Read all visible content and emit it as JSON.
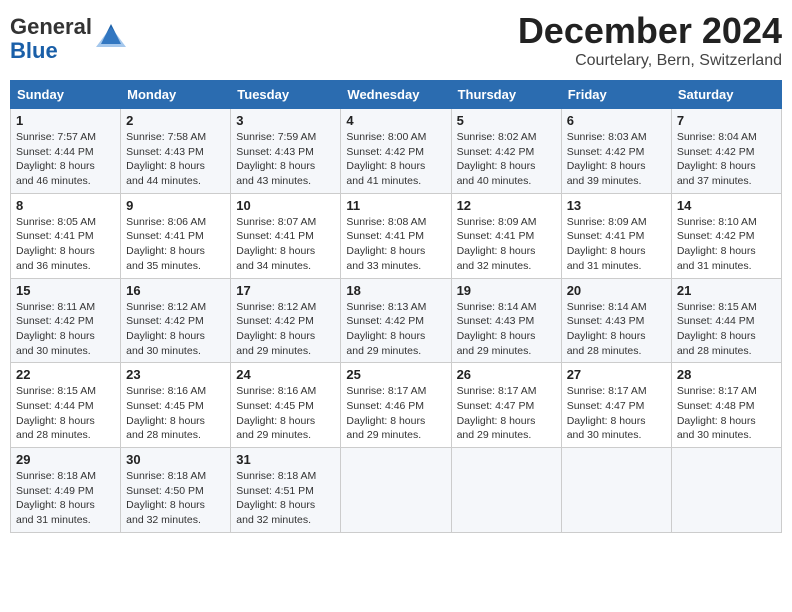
{
  "header": {
    "logo_line1": "General",
    "logo_line2": "Blue",
    "month": "December 2024",
    "location": "Courtelary, Bern, Switzerland"
  },
  "days_of_week": [
    "Sunday",
    "Monday",
    "Tuesday",
    "Wednesday",
    "Thursday",
    "Friday",
    "Saturday"
  ],
  "weeks": [
    [
      {
        "day": 1,
        "sunrise": "7:57 AM",
        "sunset": "4:44 PM",
        "daylight": "8 hours and 46 minutes."
      },
      {
        "day": 2,
        "sunrise": "7:58 AM",
        "sunset": "4:43 PM",
        "daylight": "8 hours and 44 minutes."
      },
      {
        "day": 3,
        "sunrise": "7:59 AM",
        "sunset": "4:43 PM",
        "daylight": "8 hours and 43 minutes."
      },
      {
        "day": 4,
        "sunrise": "8:00 AM",
        "sunset": "4:42 PM",
        "daylight": "8 hours and 41 minutes."
      },
      {
        "day": 5,
        "sunrise": "8:02 AM",
        "sunset": "4:42 PM",
        "daylight": "8 hours and 40 minutes."
      },
      {
        "day": 6,
        "sunrise": "8:03 AM",
        "sunset": "4:42 PM",
        "daylight": "8 hours and 39 minutes."
      },
      {
        "day": 7,
        "sunrise": "8:04 AM",
        "sunset": "4:42 PM",
        "daylight": "8 hours and 37 minutes."
      }
    ],
    [
      {
        "day": 8,
        "sunrise": "8:05 AM",
        "sunset": "4:41 PM",
        "daylight": "8 hours and 36 minutes."
      },
      {
        "day": 9,
        "sunrise": "8:06 AM",
        "sunset": "4:41 PM",
        "daylight": "8 hours and 35 minutes."
      },
      {
        "day": 10,
        "sunrise": "8:07 AM",
        "sunset": "4:41 PM",
        "daylight": "8 hours and 34 minutes."
      },
      {
        "day": 11,
        "sunrise": "8:08 AM",
        "sunset": "4:41 PM",
        "daylight": "8 hours and 33 minutes."
      },
      {
        "day": 12,
        "sunrise": "8:09 AM",
        "sunset": "4:41 PM",
        "daylight": "8 hours and 32 minutes."
      },
      {
        "day": 13,
        "sunrise": "8:09 AM",
        "sunset": "4:41 PM",
        "daylight": "8 hours and 31 minutes."
      },
      {
        "day": 14,
        "sunrise": "8:10 AM",
        "sunset": "4:42 PM",
        "daylight": "8 hours and 31 minutes."
      }
    ],
    [
      {
        "day": 15,
        "sunrise": "8:11 AM",
        "sunset": "4:42 PM",
        "daylight": "8 hours and 30 minutes."
      },
      {
        "day": 16,
        "sunrise": "8:12 AM",
        "sunset": "4:42 PM",
        "daylight": "8 hours and 30 minutes."
      },
      {
        "day": 17,
        "sunrise": "8:12 AM",
        "sunset": "4:42 PM",
        "daylight": "8 hours and 29 minutes."
      },
      {
        "day": 18,
        "sunrise": "8:13 AM",
        "sunset": "4:42 PM",
        "daylight": "8 hours and 29 minutes."
      },
      {
        "day": 19,
        "sunrise": "8:14 AM",
        "sunset": "4:43 PM",
        "daylight": "8 hours and 29 minutes."
      },
      {
        "day": 20,
        "sunrise": "8:14 AM",
        "sunset": "4:43 PM",
        "daylight": "8 hours and 28 minutes."
      },
      {
        "day": 21,
        "sunrise": "8:15 AM",
        "sunset": "4:44 PM",
        "daylight": "8 hours and 28 minutes."
      }
    ],
    [
      {
        "day": 22,
        "sunrise": "8:15 AM",
        "sunset": "4:44 PM",
        "daylight": "8 hours and 28 minutes."
      },
      {
        "day": 23,
        "sunrise": "8:16 AM",
        "sunset": "4:45 PM",
        "daylight": "8 hours and 28 minutes."
      },
      {
        "day": 24,
        "sunrise": "8:16 AM",
        "sunset": "4:45 PM",
        "daylight": "8 hours and 29 minutes."
      },
      {
        "day": 25,
        "sunrise": "8:17 AM",
        "sunset": "4:46 PM",
        "daylight": "8 hours and 29 minutes."
      },
      {
        "day": 26,
        "sunrise": "8:17 AM",
        "sunset": "4:47 PM",
        "daylight": "8 hours and 29 minutes."
      },
      {
        "day": 27,
        "sunrise": "8:17 AM",
        "sunset": "4:47 PM",
        "daylight": "8 hours and 30 minutes."
      },
      {
        "day": 28,
        "sunrise": "8:17 AM",
        "sunset": "4:48 PM",
        "daylight": "8 hours and 30 minutes."
      }
    ],
    [
      {
        "day": 29,
        "sunrise": "8:18 AM",
        "sunset": "4:49 PM",
        "daylight": "8 hours and 31 minutes."
      },
      {
        "day": 30,
        "sunrise": "8:18 AM",
        "sunset": "4:50 PM",
        "daylight": "8 hours and 32 minutes."
      },
      {
        "day": 31,
        "sunrise": "8:18 AM",
        "sunset": "4:51 PM",
        "daylight": "8 hours and 32 minutes."
      },
      null,
      null,
      null,
      null
    ]
  ]
}
